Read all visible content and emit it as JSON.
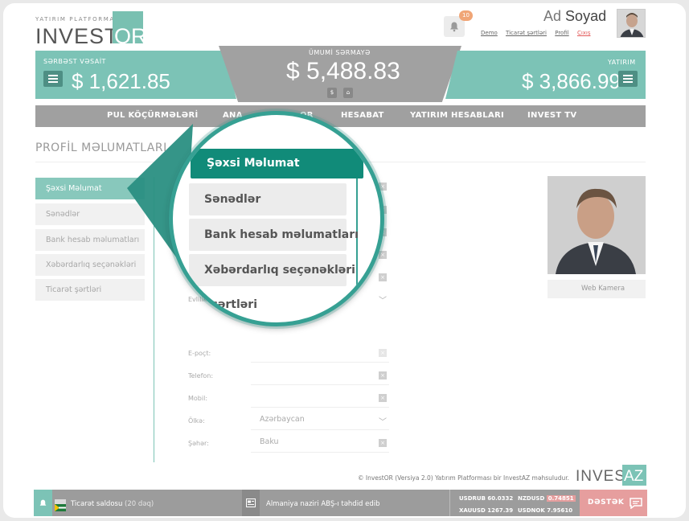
{
  "header": {
    "logo_tagline": "YATIRIM PLATFORMASI",
    "logo_word": "INVEST",
    "logo_box": "OR",
    "notification_count": "10",
    "user_first": "Ad",
    "user_last": "Soyad",
    "links": [
      "Demo",
      "Ticarət şərtləri",
      "Profil",
      "Çıxış"
    ]
  },
  "balances": {
    "free_label": "SƏRBƏST VƏSAİT",
    "free_value": "$ 1,621.85",
    "total_label": "ÜMUMİ SƏRMAYƏ",
    "total_value": "$ 5,488.83",
    "invest_label": "YATIRIM",
    "invest_value": "$ 3,866.99",
    "mini_btns": [
      "$",
      "⌂"
    ]
  },
  "nav": [
    "PUL KÖÇÜRMƏLƏRİ",
    "ANA",
    "OR",
    "HESABAT",
    "YATIRIM HESABLARI",
    "INVEST TV"
  ],
  "page_title": "PROFİL MƏLUMATLARI",
  "sidebar": [
    "Şəxsi Məlumat",
    "Sənədlər",
    "Bank hesab məlumatları",
    "Xəbərdarlıq seçənəkləri",
    "Ticarət şərtləri"
  ],
  "form": {
    "partial_label": "Ci",
    "marital_label": "Evlilik stat",
    "email_label": "E-poçt:",
    "phone_label": "Telefon:",
    "mobile_label": "Mobil:",
    "country_label": "Ölkə:",
    "country_value": "Azərbaycan",
    "city_label": "Şəhər:",
    "city_value": "Baku"
  },
  "webcam_label": "Web Kamera",
  "footer": {
    "copyright": "© InvestOR (Versiya 2.0) Yatırım Platforması bir InvestAZ məhsuludur.",
    "brand_word": "INVEST",
    "brand_box": "AZ"
  },
  "bottom_bar": {
    "news1": "Ticarət saldosu",
    "news1_time": "(20 dəq)",
    "news2": "Almaniya naziri ABŞ-ı təhdid edib",
    "rates": [
      {
        "pair": "USDRUB",
        "value": "60.0332"
      },
      {
        "pair": "NZDUSD",
        "value": "0.74851"
      },
      {
        "pair": "XAUUSD",
        "value": "1267.39"
      },
      {
        "pair": "USDNOK",
        "value": "7.95610"
      }
    ],
    "support": "DƏSTƏK"
  },
  "magnifier": {
    "items": [
      "Şəxsi Məlumat",
      "Sənədlər",
      "Bank hesab məlumatları",
      "Xəbərdarlıq seçənəkləri"
    ],
    "cut_text": "t şərtləri"
  },
  "colors": {
    "accent": "#7cc3b6",
    "accent_dark": "#118b79",
    "nav_gray": "#a0a0a0",
    "support": "#e69e9e"
  }
}
